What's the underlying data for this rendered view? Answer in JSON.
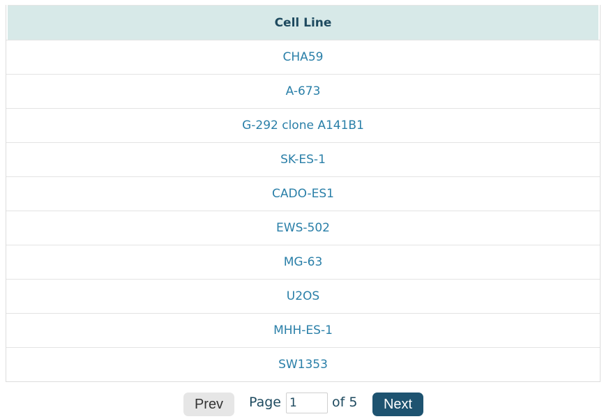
{
  "table": {
    "header": "Cell Line",
    "rows": [
      "CHA59",
      "A-673",
      "G-292 clone A141B1",
      "SK-ES-1",
      "CADO-ES1",
      "EWS-502",
      "MG-63",
      "U2OS",
      "MHH-ES-1",
      "SW1353"
    ]
  },
  "pagination": {
    "prev_label": "Prev",
    "page_label": "Page",
    "current_page": "1",
    "of_label": "of 5",
    "next_label": "Next"
  },
  "colors": {
    "header_bg": "#d7e9e8",
    "link": "#2a7fa8",
    "next_bg": "#1e5370",
    "prev_bg": "#e6e6e6"
  }
}
